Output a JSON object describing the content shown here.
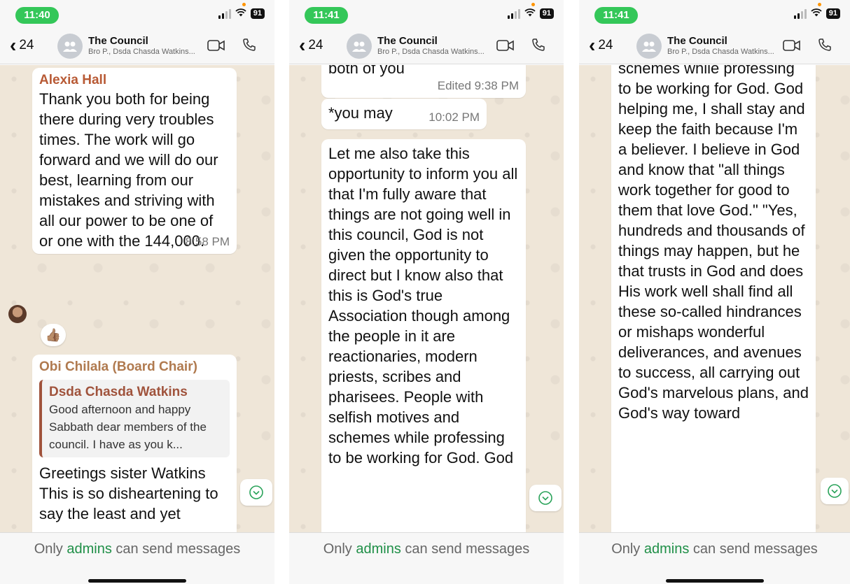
{
  "colors": {
    "accent_green": "#34c759",
    "admins_green": "#1f8f47",
    "sender_alexia": "#b85a35",
    "sender_obi": "#b07a4f",
    "quote_bar": "#a0533c",
    "chat_bg": "#efe6d8"
  },
  "panels": [
    {
      "status": {
        "time": "11:40",
        "battery": "91"
      },
      "header": {
        "back_count": "24",
        "title": "The Council",
        "subtitle": "Bro P., Dsda Chasda Watkins..."
      },
      "messages": [
        {
          "sender": "Alexia Hall",
          "text": "Thank you both for being there during very troubles times. The work will go forward and we will do our best, learning from our mistakes and striving with all our power to be one of or one with the 144,000.",
          "time": "8:58 PM",
          "reaction": "👍🏽"
        },
        {
          "sender": "Obi Chilala (Board Chair)",
          "quote_sender": "Dsda Chasda Watkins",
          "quote_text": "Good afternoon and happy Sabbath dear members of the council. I have as you k...",
          "text": "Greetings sister Watkins This is so disheartening to say the least and yet"
        }
      ],
      "footer": {
        "prefix": "Only ",
        "admins": "admins",
        "suffix": " can send messages"
      }
    },
    {
      "status": {
        "time": "11:41",
        "battery": "91"
      },
      "header": {
        "back_count": "24",
        "title": "The Council",
        "subtitle": "Bro P., Dsda Chasda Watkins..."
      },
      "messages": [
        {
          "text": "both of you",
          "time": "Edited 9:38 PM"
        },
        {
          "text": "*you may",
          "time": "10:02 PM"
        },
        {
          "text": "Let me also take this opportunity to inform you all that I'm fully aware that things are not going well in this council, God is not given the opportunity to direct but I know also that this is God's true Association though among the people in it are reactionaries, modern priests, scribes and pharisees. People with selfish motives and schemes while professing to be working for God. God"
        }
      ],
      "footer": {
        "prefix": "Only ",
        "admins": "admins",
        "suffix": " can send messages"
      }
    },
    {
      "status": {
        "time": "11:41",
        "battery": "91"
      },
      "header": {
        "back_count": "24",
        "title": "The Council",
        "subtitle": "Bro P., Dsda Chasda Watkins..."
      },
      "messages": [
        {
          "text": "schemes while professing to be working for God. God helping me, I shall stay and keep the faith because I'm a believer. I believe in God and know that \"all things work together for good to them that love God.\" \"Yes, hundreds and thousands of things may happen, but he that trusts in God and does His work well shall find all these so-called hindrances or mishaps wonderful deliverances, and avenues to success, all carrying out God's marvelous plans, and God's way toward"
        }
      ],
      "footer": {
        "prefix": "Only ",
        "admins": "admins",
        "suffix": " can send messages"
      }
    }
  ]
}
